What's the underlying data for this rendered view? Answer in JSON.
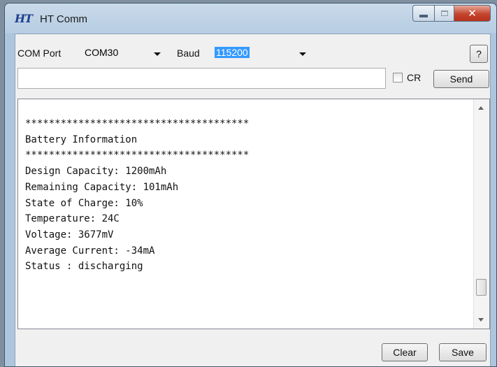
{
  "window": {
    "title": "HT Comm",
    "icon_text": "HT"
  },
  "toolbar": {
    "com_port_label": "COM Port",
    "com_port_value": "COM30",
    "baud_label": "Baud",
    "baud_value": "115200",
    "help_label": "?"
  },
  "send_bar": {
    "input_value": "",
    "cr_label": "CR",
    "cr_checked": false,
    "send_label": "Send"
  },
  "terminal": {
    "lines": [
      "**************************************",
      "Battery Information",
      "**************************************",
      "Design Capacity: 1200mAh",
      "Remaining Capacity: 101mAh",
      "State of Charge: 10%",
      "Temperature: 24C",
      "Voltage: 3677mV",
      "Average Current: -34mA",
      "Status : discharging"
    ]
  },
  "footer": {
    "clear_label": "Clear",
    "save_label": "Save"
  },
  "colors": {
    "selection": "#3399ff",
    "close_button": "#c4452f"
  }
}
